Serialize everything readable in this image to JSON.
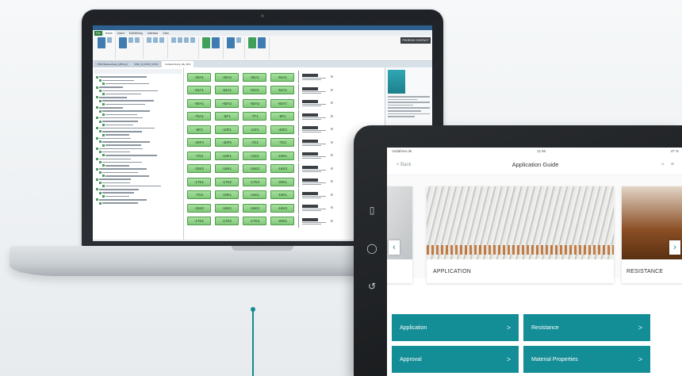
{
  "laptop": {
    "ribbon_tabs": [
      "File",
      "Home",
      "Insert",
      "Edit/Wiring",
      "Interface",
      "View"
    ],
    "ribbon_brand": "PHOENIX CONTACT",
    "doc_tabs": [
      "PMC Bestueckung_V08.nprj",
      "PNC_D_DXXX_VXXX",
      "Schaltschrank_DE_BV1"
    ],
    "terminal_rows": [
      [
        "-25A1",
        "-25A2",
        "-26A1",
        "-54A1"
      ],
      [
        "-51A1",
        "-52A1",
        "-53A1",
        "-54A1"
      ],
      [
        "-60A1",
        "-60A2",
        "-60A3",
        "-60A7"
      ],
      [
        "-75A1",
        "-5F1",
        "-7F1",
        "-8F1"
      ],
      [
        "-8F2",
        "-10F1",
        "-11F1",
        "-40F2"
      ],
      [
        "-40F4",
        "-40F6",
        "-7G1",
        "-7G2"
      ],
      [
        "-7G3",
        "-10K1",
        "-11K1",
        "-15K1"
      ],
      [
        "-15K2",
        "-16K1",
        "-16K2",
        "-16K3"
      ],
      [
        "-17K1",
        "-17K2",
        "-17K3",
        "-20K1"
      ],
      [
        "-7G3",
        "-10K1",
        "-11K1",
        "-15K1"
      ],
      [
        "-15K2",
        "-16K1",
        "-16K2",
        "-16K3"
      ],
      [
        "-17K1",
        "-17K2",
        "-17K3",
        "-20K1"
      ]
    ]
  },
  "tablet": {
    "status_left": "Vodafone.de",
    "status_time": "11:36",
    "status_right": "47 %",
    "back_label": "< Back",
    "title": "Application Guide",
    "cards": {
      "main_caption": "APPLICATION",
      "right_caption": "RESISTANCE"
    },
    "tiles": [
      "Application",
      "Resistance",
      "Approval",
      "Material Properties"
    ],
    "chevron": ">"
  },
  "colors": {
    "accent_teal": "#138d96",
    "terminal_green": "#7fc878"
  }
}
